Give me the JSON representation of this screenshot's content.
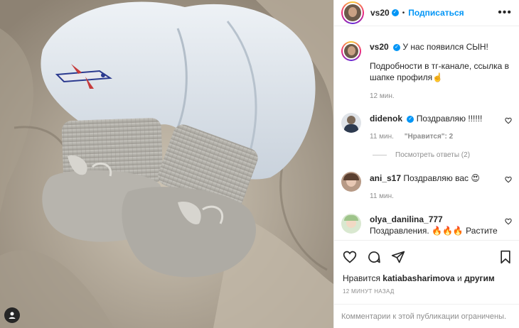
{
  "post": {
    "username": "vs20",
    "follow_label": "Подписаться",
    "dot": "•",
    "more": "•••",
    "caption_line1": "У нас появился СЫН!",
    "caption_line2": "Подробности в тг-канале, ссылка в шапке профиля",
    "caption_emoji": "☝️",
    "caption_time": "12 мин."
  },
  "comments": [
    {
      "username": "didenok",
      "verified": true,
      "text": "Поздравляю !!!!!!",
      "time": "11 мин.",
      "likes": "\"Нравится\": 2"
    },
    {
      "username": "ani_s17",
      "verified": false,
      "text": "Поздравляю вас 😍",
      "time": "11 мин."
    },
    {
      "username": "olya_danilina_777",
      "verified": false,
      "text": "Поздравления. 🔥🔥🔥 Растите здоровенькими."
    }
  ],
  "replies_label": "Посмотреть ответы (2)",
  "likes": {
    "prefix": "Нравится",
    "user": "katiabasharimova",
    "middle": "и",
    "suffix": "другим"
  },
  "post_time": "12 МИНУТ НАЗАД",
  "comments_limited": "Комментарии к этой публикации ограничены.",
  "icons": {
    "heart": "heart-icon",
    "comment": "comment-icon",
    "share": "share-icon",
    "save": "bookmark-icon",
    "verified": "verified-icon",
    "user": "user-tag-icon"
  },
  "colors": {
    "accent": "#0095f6",
    "text": "#262626",
    "muted": "#8e8e8e"
  }
}
